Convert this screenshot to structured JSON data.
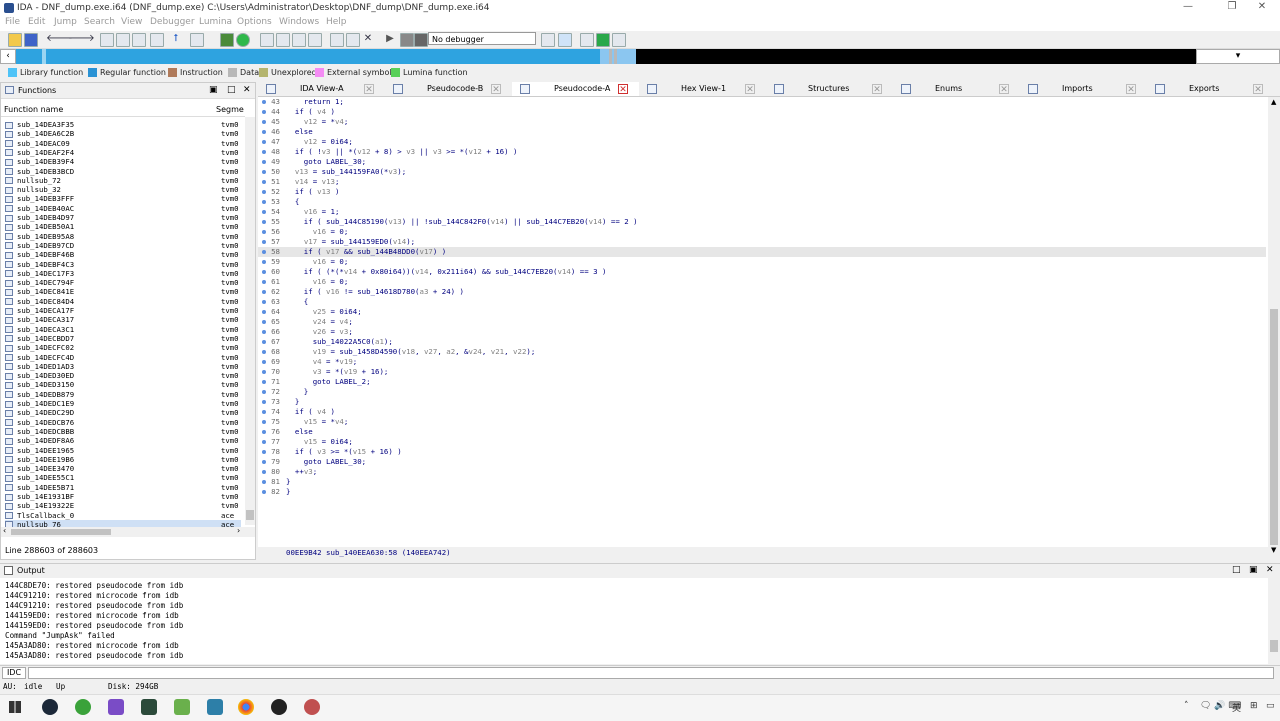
{
  "window": {
    "title": "IDA - DNF_dump.exe.i64 (DNF_dump.exe) C:\\Users\\Administrator\\Desktop\\DNF_dump\\DNF_dump.exe.i64",
    "minimize": "—",
    "restore": "❐",
    "close": "✕"
  },
  "menu": [
    "File",
    "Edit",
    "Jump",
    "Search",
    "View",
    "Debugger",
    "Lumina",
    "Options",
    "Windows",
    "Help"
  ],
  "toolbar": {
    "debugger": "No debugger"
  },
  "legend": [
    {
      "label": "Library function",
      "color": "#4fc3f7"
    },
    {
      "label": "Regular function",
      "color": "#2a92d4"
    },
    {
      "label": "Instruction",
      "color": "#b07a5a"
    },
    {
      "label": "Data",
      "color": "#b8b8b8"
    },
    {
      "label": "Unexplored",
      "color": "#b5b56e"
    },
    {
      "label": "External symbol",
      "color": "#f48cf4"
    },
    {
      "label": "Lumina function",
      "color": "#58d058"
    }
  ],
  "functions": {
    "title": "Functions",
    "col_name": "Function name",
    "col_seg": "Segme",
    "items": [
      {
        "name": "sub_14DEA3F35",
        "seg": "tvm0"
      },
      {
        "name": "sub_14DEA6C2B",
        "seg": "tvm0"
      },
      {
        "name": "sub_14DEAC09",
        "seg": "tvm0"
      },
      {
        "name": "sub_14DEAF2F4",
        "seg": "tvm0"
      },
      {
        "name": "sub_14DEB39F4",
        "seg": "tvm0"
      },
      {
        "name": "sub_14DEB3BCD",
        "seg": "tvm0"
      },
      {
        "name": "nullsub_72",
        "seg": "tvm0"
      },
      {
        "name": "nullsub_32",
        "seg": "tvm0"
      },
      {
        "name": "sub_14DEB3FFF",
        "seg": "tvm0"
      },
      {
        "name": "sub_14DEB40AC",
        "seg": "tvm0"
      },
      {
        "name": "sub_14DEB4D97",
        "seg": "tvm0"
      },
      {
        "name": "sub_14DEB50A1",
        "seg": "tvm0"
      },
      {
        "name": "sub_14DEB95A8",
        "seg": "tvm0"
      },
      {
        "name": "sub_14DEB97CD",
        "seg": "tvm0"
      },
      {
        "name": "sub_14DEBF46B",
        "seg": "tvm0"
      },
      {
        "name": "sub_14DEBF4C3",
        "seg": "tvm0"
      },
      {
        "name": "sub_14DEC17F3",
        "seg": "tvm0"
      },
      {
        "name": "sub_14DEC794F",
        "seg": "tvm0"
      },
      {
        "name": "sub_14DEC841E",
        "seg": "tvm0"
      },
      {
        "name": "sub_14DEC84D4",
        "seg": "tvm0"
      },
      {
        "name": "sub_14DECA17F",
        "seg": "tvm0"
      },
      {
        "name": "sub_14DECA317",
        "seg": "tvm0"
      },
      {
        "name": "sub_14DECA3C1",
        "seg": "tvm0"
      },
      {
        "name": "sub_14DECBDD7",
        "seg": "tvm0"
      },
      {
        "name": "sub_14DECFC02",
        "seg": "tvm0"
      },
      {
        "name": "sub_14DECFC4D",
        "seg": "tvm0"
      },
      {
        "name": "sub_14DED1AD3",
        "seg": "tvm0"
      },
      {
        "name": "sub_14DED30ED",
        "seg": "tvm0"
      },
      {
        "name": "sub_14DED3150",
        "seg": "tvm0"
      },
      {
        "name": "sub_14DEDB879",
        "seg": "tvm0"
      },
      {
        "name": "sub_14DEDC1E9",
        "seg": "tvm0"
      },
      {
        "name": "sub_14DEDC29D",
        "seg": "tvm0"
      },
      {
        "name": "sub_14DEDCB76",
        "seg": "tvm0"
      },
      {
        "name": "sub_14DEDCBBB",
        "seg": "tvm0"
      },
      {
        "name": "sub_14DEDF8A6",
        "seg": "tvm0"
      },
      {
        "name": "sub_14DEE1965",
        "seg": "tvm0"
      },
      {
        "name": "sub_14DEE19B6",
        "seg": "tvm0"
      },
      {
        "name": "sub_14DEE3470",
        "seg": "tvm0"
      },
      {
        "name": "sub_14DEE55C1",
        "seg": "tvm0"
      },
      {
        "name": "sub_14DEE5B71",
        "seg": "tvm0"
      },
      {
        "name": "sub_14E1931BF",
        "seg": "tvm0"
      },
      {
        "name": "sub_14E19322E",
        "seg": "tvm0"
      },
      {
        "name": "TlsCallback_0",
        "seg": "ace"
      },
      {
        "name": "nullsub_76",
        "seg": "ace"
      }
    ],
    "status": "Line 288603 of 288603"
  },
  "tabs": [
    {
      "label": "IDA View-A"
    },
    {
      "label": "Pseudocode-B"
    },
    {
      "label": "Pseudocode-A"
    },
    {
      "label": "Hex View-1"
    },
    {
      "label": "Structures"
    },
    {
      "label": "Enums"
    },
    {
      "label": "Imports"
    },
    {
      "label": "Exports"
    }
  ],
  "code": [
    {
      "n": "43",
      "t": "    return 1;"
    },
    {
      "n": "44",
      "t": "  if ( v4 )"
    },
    {
      "n": "45",
      "t": "    v12 = *v4;"
    },
    {
      "n": "46",
      "t": "  else"
    },
    {
      "n": "47",
      "t": "    v12 = 0i64;"
    },
    {
      "n": "48",
      "t": "  if ( !v3 || *(v12 + 8) > v3 || v3 >= *(v12 + 16) )"
    },
    {
      "n": "49",
      "t": "    goto LABEL_30;"
    },
    {
      "n": "50",
      "t": "  v13 = sub_144159FA0(*v3);"
    },
    {
      "n": "51",
      "t": "  v14 = v13;"
    },
    {
      "n": "52",
      "t": "  if ( v13 )"
    },
    {
      "n": "53",
      "t": "  {"
    },
    {
      "n": "54",
      "t": "    v16 = 1;"
    },
    {
      "n": "55",
      "t": "    if ( sub_144C85190(v13) || !sub_144C842F0(v14) || sub_144C7EB20(v14) == 2 )"
    },
    {
      "n": "56",
      "t": "      v16 = 0;"
    },
    {
      "n": "57",
      "t": "    v17 = sub_144159ED0(v14);"
    },
    {
      "n": "58",
      "t": "    if ( v17 && sub_144B48DD0(v17) )"
    },
    {
      "n": "59",
      "t": "      v16 = 0;"
    },
    {
      "n": "60",
      "t": "    if ( (*(*v14 + 0x80i64))(v14, 0x211i64) && sub_144C7EB20(v14) == 3 )"
    },
    {
      "n": "61",
      "t": "      v16 = 0;"
    },
    {
      "n": "62",
      "t": "    if ( v16 != sub_14618D780(a3 + 24) )"
    },
    {
      "n": "63",
      "t": "    {"
    },
    {
      "n": "64",
      "t": "      v25 = 0i64;"
    },
    {
      "n": "65",
      "t": "      v24 = v4;"
    },
    {
      "n": "66",
      "t": "      v26 = v3;"
    },
    {
      "n": "67",
      "t": "      sub_14022A5C0(a1);"
    },
    {
      "n": "68",
      "t": "      v19 = sub_1458D4590(v18, v27, a2, &v24, v21, v22);"
    },
    {
      "n": "69",
      "t": "      v4 = *v19;"
    },
    {
      "n": "70",
      "t": "      v3 = *(v19 + 16);"
    },
    {
      "n": "71",
      "t": "      goto LABEL_2;"
    },
    {
      "n": "72",
      "t": "    }"
    },
    {
      "n": "73",
      "t": "  }"
    },
    {
      "n": "74",
      "t": "  if ( v4 )"
    },
    {
      "n": "75",
      "t": "    v15 = *v4;"
    },
    {
      "n": "76",
      "t": "  else"
    },
    {
      "n": "77",
      "t": "    v15 = 0i64;"
    },
    {
      "n": "78",
      "t": "  if ( v3 >= *(v15 + 16) )"
    },
    {
      "n": "79",
      "t": "    goto LABEL_30;"
    },
    {
      "n": "80",
      "t": "  ++v3;"
    },
    {
      "n": "81",
      "t": "}"
    },
    {
      "n": "82",
      "t": "}"
    }
  ],
  "code_status": "00EE9B42 sub_140EEA630:58 (140EEA742)",
  "output": {
    "title": "Output",
    "lines": [
      "144C8DE70: restored pseudocode from idb",
      "144C91210: restored microcode from idb",
      "144C91210: restored pseudocode from idb",
      "144159ED0: restored microcode from idb",
      "144159ED0: restored pseudocode from idb",
      "Command \"JumpAsk\" failed",
      "145A3AD80: restored microcode from idb",
      "145A3AD80: restored pseudocode from idb"
    ]
  },
  "idc": "IDC",
  "statusbar": {
    "au": "AU:",
    "state": "idle",
    "dir": "Up",
    "disk": "Disk: 294GB"
  },
  "tray": {
    "ime": "英",
    "time": "",
    "icons": "🗨 🔊 ⌨"
  }
}
